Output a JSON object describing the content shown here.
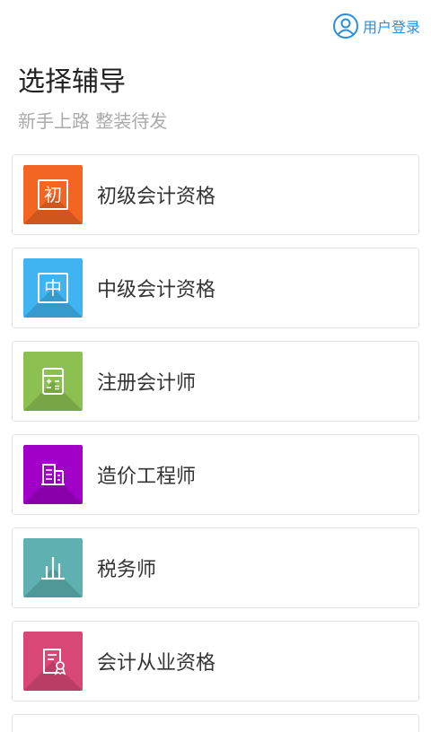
{
  "header": {
    "login_label": "用户登录",
    "title": "选择辅导",
    "subtitle": "新手上路  整装待发"
  },
  "courses": [
    {
      "label": "初级会计资格",
      "icon": "char-chu-icon",
      "glyph": "初",
      "color": "#f26522"
    },
    {
      "label": "中级会计资格",
      "icon": "char-zhong-icon",
      "glyph": "中",
      "color": "#3fb4f0"
    },
    {
      "label": "注册会计师",
      "icon": "calculator-icon",
      "color": "#8cc152"
    },
    {
      "label": "造价工程师",
      "icon": "building-icon",
      "color": "#a000c8"
    },
    {
      "label": "税务师",
      "icon": "bar-chart-icon",
      "color": "#5eb1b0"
    },
    {
      "label": "会计从业资格",
      "icon": "certificate-icon",
      "color": "#d94777"
    }
  ],
  "colors": {
    "accent": "#2a8de0"
  }
}
